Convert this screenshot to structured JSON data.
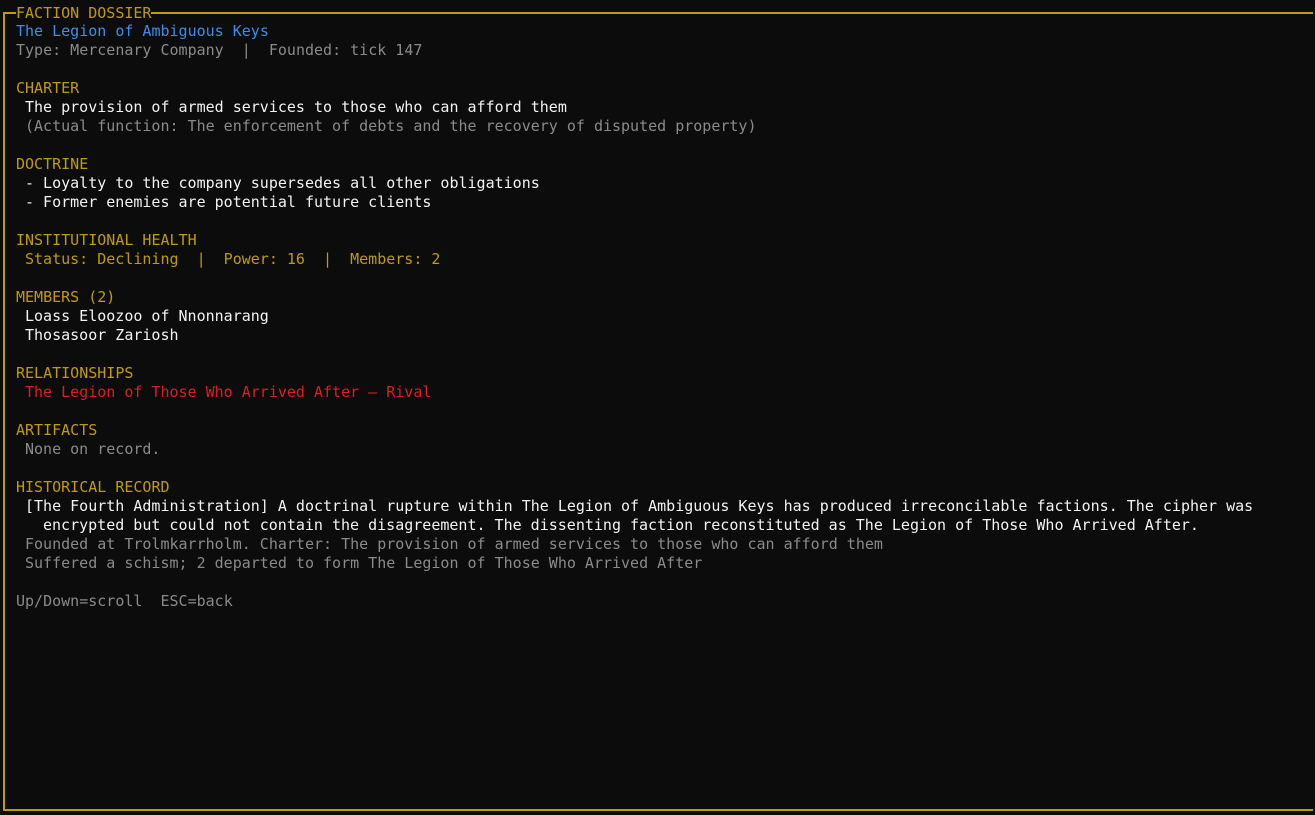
{
  "header": {
    "panel_title": "FACTION DOSSIER",
    "faction_name": "The Legion of Ambiguous Keys",
    "meta": "Type: Mercenary Company  |  Founded: tick 147"
  },
  "charter": {
    "heading": "CHARTER",
    "text": "The provision of armed services to those who can afford them",
    "actual": "(Actual function: The enforcement of debts and the recovery of disputed property)"
  },
  "doctrine": {
    "heading": "DOCTRINE",
    "items": [
      "- Loyalty to the company supersedes all other obligations",
      "- Former enemies are potential future clients"
    ]
  },
  "health": {
    "heading": "INSTITUTIONAL HEALTH",
    "status_line": "Status: Declining  |  Power: 16  |  Members: 2"
  },
  "members": {
    "heading": "MEMBERS (2)",
    "items": [
      "Loass Eloozoo of Nnonnarang",
      "Thosasoor Zariosh"
    ]
  },
  "relationships": {
    "heading": "RELATIONSHIPS",
    "items": [
      "The Legion of Those Who Arrived After — Rival"
    ]
  },
  "artifacts": {
    "heading": "ARTIFACTS",
    "empty_text": "None on record."
  },
  "history": {
    "heading": "HISTORICAL RECORD",
    "entry_line1": "[The Fourth Administration] A doctrinal rupture within The Legion of Ambiguous Keys has produced irreconcilable factions. The cipher was",
    "entry_line2": "encrypted but could not contain the disagreement. The dissenting faction reconstituted as The Legion of Those Who Arrived After.",
    "notes": [
      "Founded at Trolmkarrholm. Charter: The provision of armed services to those who can afford them",
      "Suffered a schism; 2 departed to form The Legion of Those Who Arrived After"
    ]
  },
  "footer": {
    "hint": "Up/Down=scroll  ESC=back"
  },
  "colors": {
    "frame": "#c19c00",
    "heading": "#c19c00",
    "title": "#3b8eea",
    "rival": "#e01b24",
    "background": "#0c0c0c"
  }
}
